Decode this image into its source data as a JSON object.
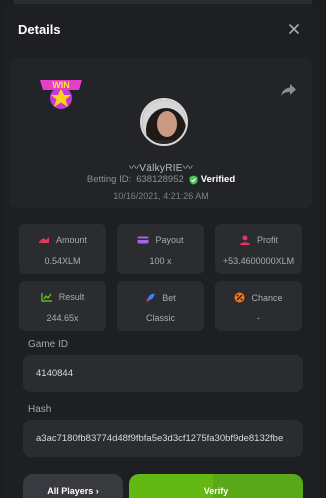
{
  "modal": {
    "title": "Details"
  },
  "player": {
    "username": "〰VälkyRIE〰",
    "betting_id_label": "Betting ID:",
    "betting_id": "638128952",
    "verified_label": "Verified",
    "timestamp": "10/16/2021, 4:21:26 AM"
  },
  "stats": [
    {
      "label": "Amount",
      "value": "0.54XLM",
      "icon": "money-icon",
      "color": "#e2355f"
    },
    {
      "label": "Payout",
      "value": "100 x",
      "icon": "wallet-icon",
      "color": "#a566e8"
    },
    {
      "label": "Profit",
      "value": "+53.4600000XLM",
      "icon": "user-profit-icon",
      "color": "#e2355f"
    },
    {
      "label": "Result",
      "value": "244.65x",
      "icon": "chart-icon",
      "color": "#6fcb2b"
    },
    {
      "label": "Bet",
      "value": "Classic",
      "icon": "rocket-icon",
      "color": "#3d7bff"
    },
    {
      "label": "Chance",
      "value": "-",
      "icon": "chance-icon",
      "color": "#ef7a21"
    }
  ],
  "game": {
    "game_id_label": "Game ID",
    "game_id": "4140844",
    "hash_label": "Hash",
    "hash": "a3ac7180fb83774d48f9fbfa5e3d3cf1275fa30bf9de8132fbe"
  },
  "actions": {
    "all_players_label": "All Players ›",
    "verify_label": "Verify"
  },
  "colors": {
    "accent_green": "#64b814",
    "verified_green": "#47c95a"
  }
}
